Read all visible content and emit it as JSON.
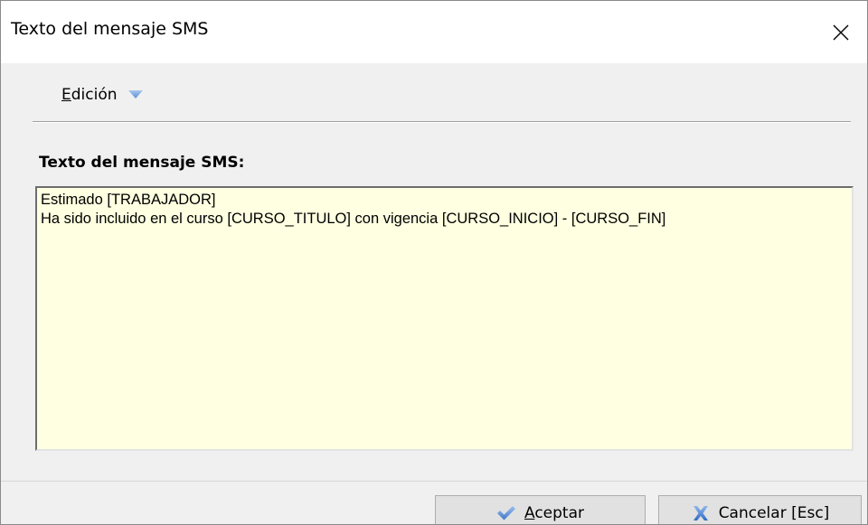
{
  "window": {
    "title": "Texto del mensaje SMS"
  },
  "menu": {
    "edit": {
      "mnemonic": "E",
      "rest": "dición"
    }
  },
  "form": {
    "label": "Texto del mensaje SMS:",
    "message": "Estimado [TRABAJADOR]\nHa sido incluido en el curso [CURSO_TITULO] con vigencia [CURSO_INICIO] - [CURSO_FIN]"
  },
  "buttons": {
    "accept": {
      "mnemonic": "A",
      "rest": "ceptar"
    },
    "cancel": {
      "label": "Cancelar [Esc]"
    }
  },
  "colors": {
    "textarea_bg": "#ffffe1",
    "accent_arrow": "#7ea6e0",
    "check_icon": "#5b8fd6",
    "cancel_icon": "#3f7fd1"
  },
  "icons": {
    "close": "close-icon",
    "menu_arrow": "dropdown-triangle-icon",
    "accept": "checkmark-icon",
    "cancel": "x-cross-icon"
  }
}
